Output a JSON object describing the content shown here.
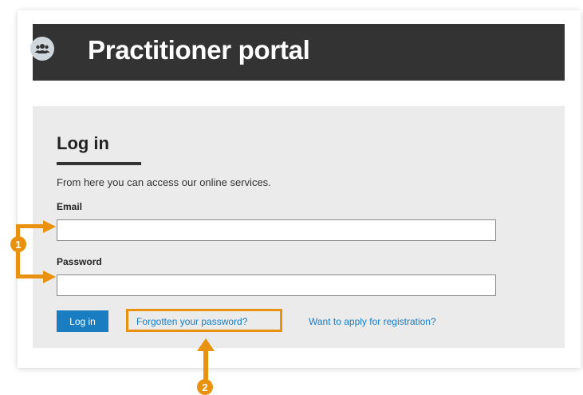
{
  "header": {
    "title": "Practitioner portal",
    "icon": "users-group-icon"
  },
  "login": {
    "heading": "Log in",
    "intro": "From here you can access our online services.",
    "email_label": "Email",
    "email_value": "",
    "password_label": "Password",
    "password_value": "",
    "submit_label": "Log in",
    "forgot_link": "Forgotten your password?",
    "register_link": "Want to apply for registration?"
  },
  "annotations": {
    "marker_1": "1",
    "marker_2": "2",
    "color": "#e8920f"
  },
  "colors": {
    "header_bg": "#333333",
    "panel_bg": "#ebebeb",
    "accent_blue": "#1a7dc2"
  }
}
